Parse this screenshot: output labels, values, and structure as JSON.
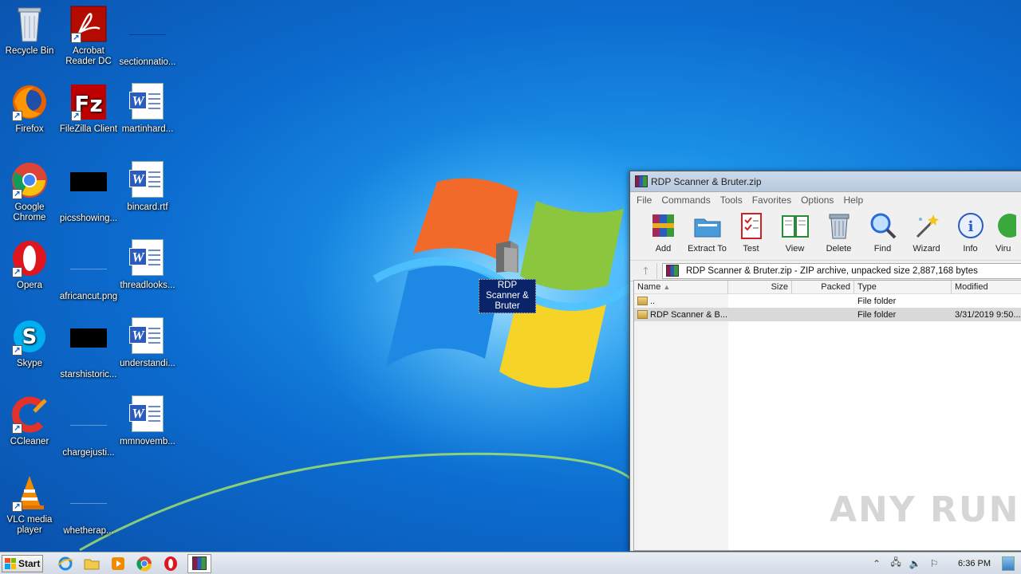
{
  "desktop": {
    "icons": [
      {
        "label": "Recycle Bin"
      },
      {
        "label": "Acrobat Reader DC"
      },
      {
        "label": "sectionnatio..."
      },
      {
        "label": "Firefox"
      },
      {
        "label": "FileZilla Client"
      },
      {
        "label": "martinhard..."
      },
      {
        "label": "Google Chrome"
      },
      {
        "label": "picsshowing..."
      },
      {
        "label": "bincard.rtf"
      },
      {
        "label": "Opera"
      },
      {
        "label": "africancut.png"
      },
      {
        "label": "threadlooks..."
      },
      {
        "label": "Skype"
      },
      {
        "label": "starshistoric..."
      },
      {
        "label": "understandi..."
      },
      {
        "label": "CCleaner"
      },
      {
        "label": "chargejusti..."
      },
      {
        "label": "mmnovemb..."
      },
      {
        "label": "VLC media player"
      },
      {
        "label": "whetherap..."
      }
    ],
    "selected_folder": {
      "label": "RDP Scanner & Bruter"
    }
  },
  "winrar": {
    "title": "RDP Scanner & Bruter.zip",
    "menu": [
      "File",
      "Commands",
      "Tools",
      "Favorites",
      "Options",
      "Help"
    ],
    "toolbar": [
      "Add",
      "Extract To",
      "Test",
      "View",
      "Delete",
      "Find",
      "Wizard",
      "Info",
      "Viru"
    ],
    "path": "RDP Scanner & Bruter.zip - ZIP archive, unpacked size 2,887,168 bytes",
    "columns": {
      "name": "Name",
      "size": "Size",
      "packed": "Packed",
      "type": "Type",
      "modified": "Modified"
    },
    "rows": [
      {
        "name": "..",
        "size": "",
        "packed": "",
        "type": "File folder",
        "modified": ""
      },
      {
        "name": "RDP Scanner & B...",
        "size": "",
        "packed": "",
        "type": "File folder",
        "modified": "3/31/2019 9:50..."
      }
    ]
  },
  "watermark": "ANY RUN",
  "taskbar": {
    "start_label": "Start",
    "clock": "6:36 PM"
  }
}
